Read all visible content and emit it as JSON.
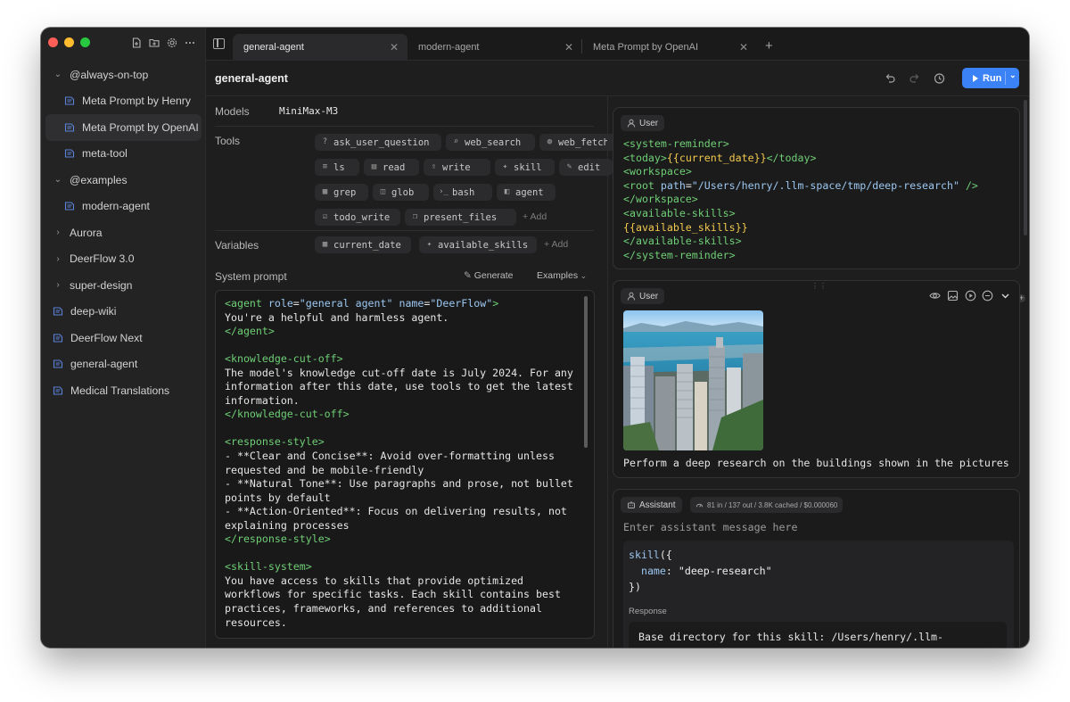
{
  "sidebar": {
    "items": [
      {
        "label": "@always-on-top",
        "kind": "group"
      },
      {
        "label": "Meta Prompt by Henry",
        "kind": "child"
      },
      {
        "label": "Meta Prompt by OpenAI",
        "kind": "child",
        "active": true
      },
      {
        "label": "meta-tool",
        "kind": "child"
      },
      {
        "label": "@examples",
        "kind": "group"
      },
      {
        "label": "modern-agent",
        "kind": "child"
      },
      {
        "label": "Aurora",
        "kind": "folder"
      },
      {
        "label": "DeerFlow 3.0",
        "kind": "folder"
      },
      {
        "label": "super-design",
        "kind": "folder"
      },
      {
        "label": "deep-wiki",
        "kind": "file"
      },
      {
        "label": "DeerFlow Next",
        "kind": "file"
      },
      {
        "label": "general-agent",
        "kind": "file"
      },
      {
        "label": "Medical Translations",
        "kind": "file"
      }
    ]
  },
  "tabs": [
    {
      "label": "general-agent",
      "active": true
    },
    {
      "label": "modern-agent"
    },
    {
      "label": "Meta Prompt by OpenAI"
    }
  ],
  "header": {
    "title": "general-agent",
    "run_label": "Run"
  },
  "config": {
    "models_label": "Models",
    "model": "MiniMax-M3",
    "tools_label": "Tools",
    "tools": [
      "ask_user_question",
      "web_search",
      "web_fetch",
      "ls",
      "read",
      "write",
      "skill",
      "edit",
      "grep",
      "glob",
      "bash",
      "agent",
      "todo_write",
      "present_files"
    ],
    "add_label": "Add",
    "variables_label": "Variables",
    "variables": [
      "current_date",
      "available_skills"
    ],
    "system_prompt_label": "System prompt",
    "generate_label": "Generate",
    "examples_label": "Examples"
  },
  "system_prompt_lines": [
    "<agent role=\"general agent\" name=\"DeerFlow\">",
    "You're a helpful and harmless agent.",
    "</agent>",
    "",
    "<knowledge-cut-off>",
    "The model's knowledge cut-off date is July 2024. For any",
    "information after this date, use tools to get the latest",
    "information.",
    "</knowledge-cut-off>",
    "",
    "<response-style>",
    "- **Clear and Concise**: Avoid over-formatting unless",
    "requested and be mobile-friendly",
    "- **Natural Tone**: Use paragraphs and prose, not bullet",
    "points by default",
    "- **Action-Oriented**: Focus on delivering results, not",
    "explaining processes",
    "</response-style>",
    "",
    "<skill-system>",
    "You have access to skills that provide optimized",
    "workflows for specific tasks. Each skill contains best",
    "practices, frameworks, and references to additional",
    "resources."
  ],
  "messages": {
    "user_label": "User",
    "assistant_label": "Assistant",
    "msg1_lines": [
      "<system-reminder>",
      "<today>{{current_date}}</today>",
      "<workspace>",
      "<root path=\"/Users/henry/.llm-space/tmp/deep-research\" />",
      "</workspace>",
      "<available-skills>",
      "{{available_skills}}",
      "</available-skills>",
      "</system-reminder>"
    ],
    "msg2_caption": "Perform a deep research on the buildings shown in the pictures",
    "usage": "81 in / 137 out / 3.8K cached / $0.000060",
    "assistant_placeholder": "Enter assistant message here",
    "tool_call": {
      "fn": "skill",
      "arg_name": "name",
      "arg_value": "\"deep-research\""
    },
    "response_label": "Response",
    "response_text": "Base directory for this skill: /Users/henry/.llm-"
  },
  "colors": {
    "accent": "#3b82f6",
    "tag": "#6fcf75",
    "attr": "#9cc7f0",
    "template_var": "#f2c94c"
  }
}
